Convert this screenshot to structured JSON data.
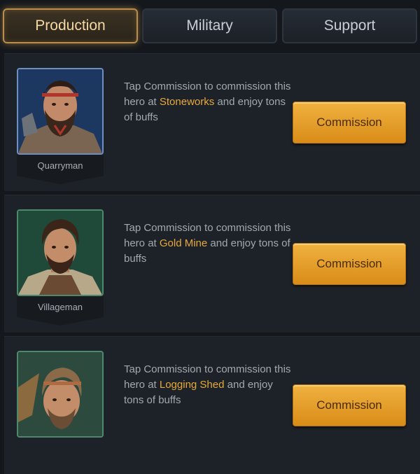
{
  "tabs": [
    {
      "label": "Production",
      "active": true
    },
    {
      "label": "Military",
      "active": false
    },
    {
      "label": "Support",
      "active": false
    }
  ],
  "heroes": [
    {
      "name": "Quarryman",
      "desc_before": "Tap Commission to commission this hero at ",
      "building": "Stoneworks",
      "desc_after": " and enjoy tons of buffs",
      "button": "Commission"
    },
    {
      "name": "Villageman",
      "desc_before": "Tap Commission to commission this hero at ",
      "building": "Gold Mine",
      "desc_after": " and enjoy tons of buffs",
      "button": "Commission"
    },
    {
      "name": "",
      "desc_before": "Tap Commission to commission this hero at ",
      "building": "Logging Shed",
      "desc_after": " and enjoy tons of buffs",
      "button": "Commission"
    }
  ],
  "colors": {
    "accent": "#e6a93a",
    "button": "#e39d28",
    "background": "#14181d"
  }
}
